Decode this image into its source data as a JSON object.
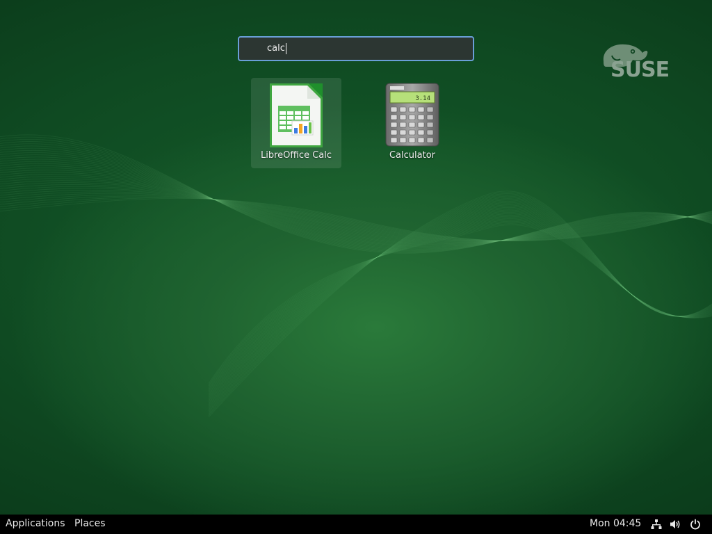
{
  "desktop": {
    "brand_logo": "SUSE",
    "colors": {
      "background": "#0f4a22",
      "accent": "#6a9fd8"
    }
  },
  "search": {
    "value": "calc",
    "icon": "none-visible"
  },
  "results": [
    {
      "label": "LibreOffice Calc",
      "icon": "libreoffice-calc-icon",
      "selected": true
    },
    {
      "label": "Calculator",
      "icon": "calculator-icon",
      "display": "3.14",
      "selected": false
    }
  ],
  "panel": {
    "applications_label": "Applications",
    "places_label": "Places",
    "clock": "Mon 04:45",
    "status_icons": [
      "network-icon",
      "volume-icon",
      "power-icon"
    ]
  }
}
